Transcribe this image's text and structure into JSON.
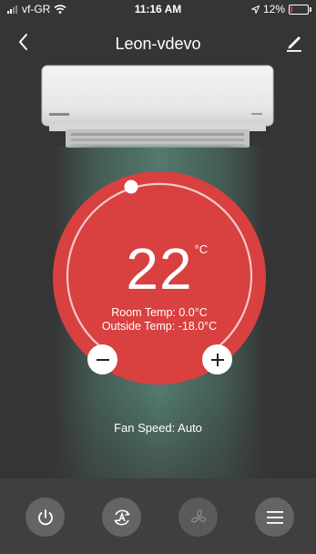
{
  "status_bar": {
    "carrier": "vf-GR",
    "time": "11:16 AM",
    "battery_percent": "12%",
    "battery_level": 0.12,
    "icons": [
      "signal-icon",
      "wifi-icon",
      "location-arrow-icon",
      "battery-icon"
    ]
  },
  "nav": {
    "title": "Leon-vdevo",
    "back_icon": "back-chevron-icon",
    "edit_icon": "edit-pencil-icon"
  },
  "thermostat": {
    "set_temp": "22",
    "unit": "°C",
    "room_temp": "Room Temp: 0.0°C",
    "outside_temp": "Outside Temp: -18.0°C",
    "decrease_icon": "minus-icon",
    "increase_icon": "plus-icon"
  },
  "fan_speed": "Fan Speed: Auto",
  "bottom_bar": {
    "buttons": [
      "power-icon",
      "auto-mode-icon",
      "fan-icon",
      "menu-icon"
    ]
  },
  "colors": {
    "background": "#353535",
    "dial": "#d94040",
    "glow": "#5f8f82",
    "bottom_bar": "#3f3f3f",
    "bottom_button": "#646464",
    "battery_low": "#e53935"
  }
}
